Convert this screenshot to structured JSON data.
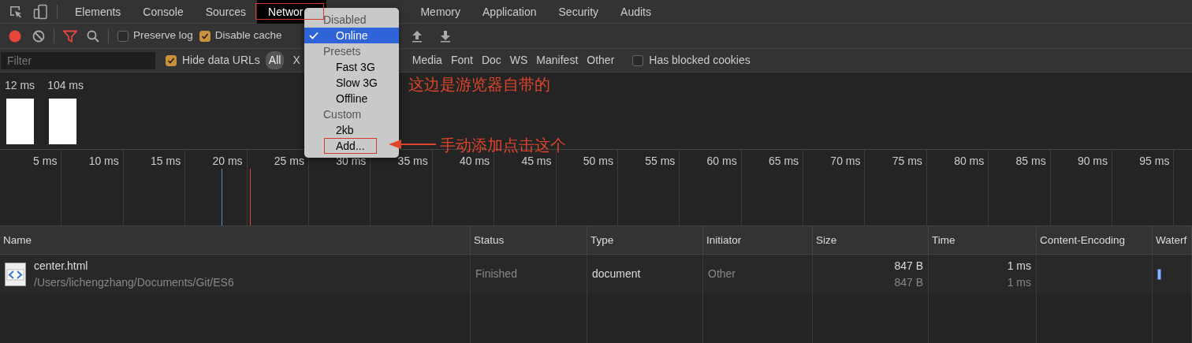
{
  "tabs": [
    {
      "label": "Elements",
      "selected": false
    },
    {
      "label": "Console",
      "selected": false
    },
    {
      "label": "Sources",
      "selected": false
    },
    {
      "label": "Networ",
      "selected": true
    },
    {
      "label": "Memory",
      "selected": false
    },
    {
      "label": "Application",
      "selected": false
    },
    {
      "label": "Security",
      "selected": false
    },
    {
      "label": "Audits",
      "selected": false
    }
  ],
  "toolbar": {
    "recording": true,
    "preserve_log": {
      "label": "Preserve log",
      "checked": false
    },
    "disable_cache": {
      "label": "Disable cache",
      "checked": true
    }
  },
  "filter": {
    "placeholder": "Filter",
    "hide_data_urls": {
      "label": "Hide data URLs",
      "checked": true
    },
    "types_left": [
      {
        "label": "All",
        "selected": true
      },
      {
        "label": "X",
        "selected": false
      }
    ],
    "types_right": [
      {
        "label": "Media",
        "selected": false
      },
      {
        "label": "Font",
        "selected": false
      },
      {
        "label": "Doc",
        "selected": false
      },
      {
        "label": "WS",
        "selected": false
      },
      {
        "label": "Manifest",
        "selected": false
      },
      {
        "label": "Other",
        "selected": false
      }
    ],
    "blocked_cookies": {
      "label": "Has blocked cookies",
      "checked": false
    }
  },
  "screenshots": [
    {
      "time": "12 ms"
    },
    {
      "time": "104 ms"
    }
  ],
  "overview": {
    "ticks": [
      "5 ms",
      "10 ms",
      "15 ms",
      "20 ms",
      "25 ms",
      "30 ms",
      "35 ms",
      "40 ms",
      "45 ms",
      "50 ms",
      "55 ms",
      "60 ms",
      "65 ms",
      "70 ms",
      "75 ms",
      "80 ms",
      "85 ms",
      "90 ms",
      "95 ms"
    ]
  },
  "table": {
    "columns": [
      "Name",
      "Status",
      "Type",
      "Initiator",
      "Size",
      "Time",
      "Content-Encoding",
      "Waterf"
    ],
    "rows": [
      {
        "name": "center.html",
        "path": "/Users/lichengzhang/Documents/Git/ES6",
        "status": "Finished",
        "type": "document",
        "initiator": "Other",
        "size": "847 B",
        "resource_size": "847 B",
        "time": "1 ms",
        "latency": "1 ms"
      }
    ]
  },
  "throttle_menu": {
    "items": [
      {
        "kind": "header",
        "label": "Disabled"
      },
      {
        "kind": "option",
        "label": "Online",
        "selected": true
      },
      {
        "kind": "header",
        "label": "Presets"
      },
      {
        "kind": "option",
        "label": "Fast 3G",
        "selected": false
      },
      {
        "kind": "option",
        "label": "Slow 3G",
        "selected": false
      },
      {
        "kind": "option",
        "label": "Offline",
        "selected": false
      },
      {
        "kind": "header",
        "label": "Custom"
      },
      {
        "kind": "option",
        "label": "2kb",
        "selected": false
      },
      {
        "kind": "option",
        "label": "Add...",
        "selected": false,
        "highlighted": true
      }
    ]
  },
  "annotations": [
    {
      "text": "这边是游览器自带的"
    },
    {
      "text": "手动添加点击这个"
    }
  ]
}
